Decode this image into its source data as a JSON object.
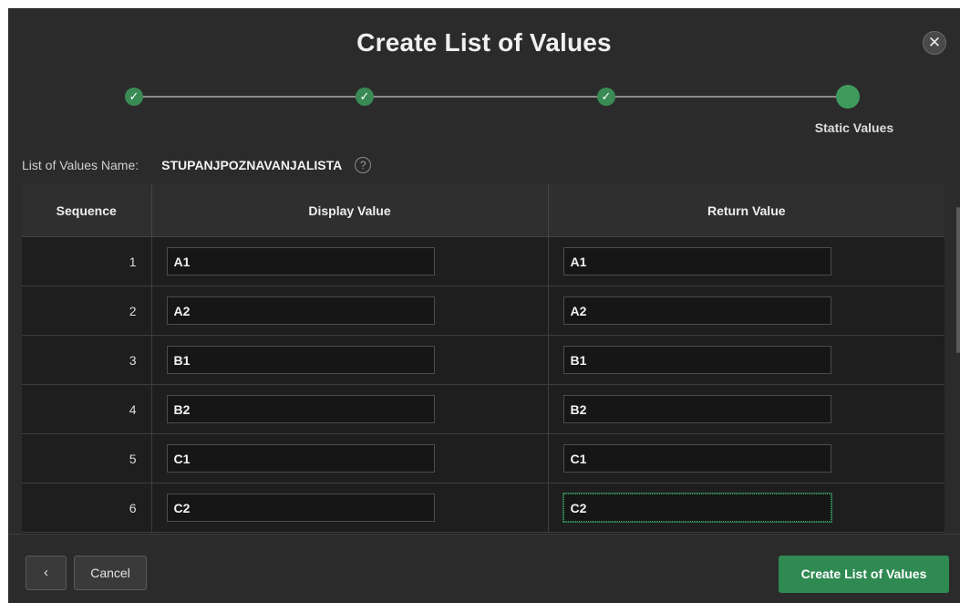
{
  "dialog": {
    "title": "Create List of Values",
    "close_icon": "close-icon"
  },
  "wizard": {
    "steps": [
      {
        "state": "complete",
        "icon": "check-icon"
      },
      {
        "state": "complete",
        "icon": "check-icon"
      },
      {
        "state": "complete",
        "icon": "check-icon"
      },
      {
        "state": "current",
        "label": "Static Values"
      }
    ],
    "current_label": "Static Values",
    "accent_color": "#3a8a56"
  },
  "lov": {
    "name_label": "List of Values Name:",
    "name_value": "STUPANJPOZNAVANJALISTA",
    "help_icon": "help-icon"
  },
  "grid": {
    "columns": [
      "Sequence",
      "Display Value",
      "Return Value"
    ],
    "rows": [
      {
        "sequence": "1",
        "display": "A1",
        "return": "A1"
      },
      {
        "sequence": "2",
        "display": "A2",
        "return": "A2"
      },
      {
        "sequence": "3",
        "display": "B1",
        "return": "B1"
      },
      {
        "sequence": "4",
        "display": "B2",
        "return": "B2"
      },
      {
        "sequence": "5",
        "display": "C1",
        "return": "C1"
      },
      {
        "sequence": "6",
        "display": "C2",
        "return": "C2"
      }
    ]
  },
  "footer": {
    "back_icon": "chevron-left-icon",
    "back_label": "‹",
    "cancel_label": "Cancel",
    "create_label": "Create List of Values",
    "create_color": "#2f8a52"
  }
}
